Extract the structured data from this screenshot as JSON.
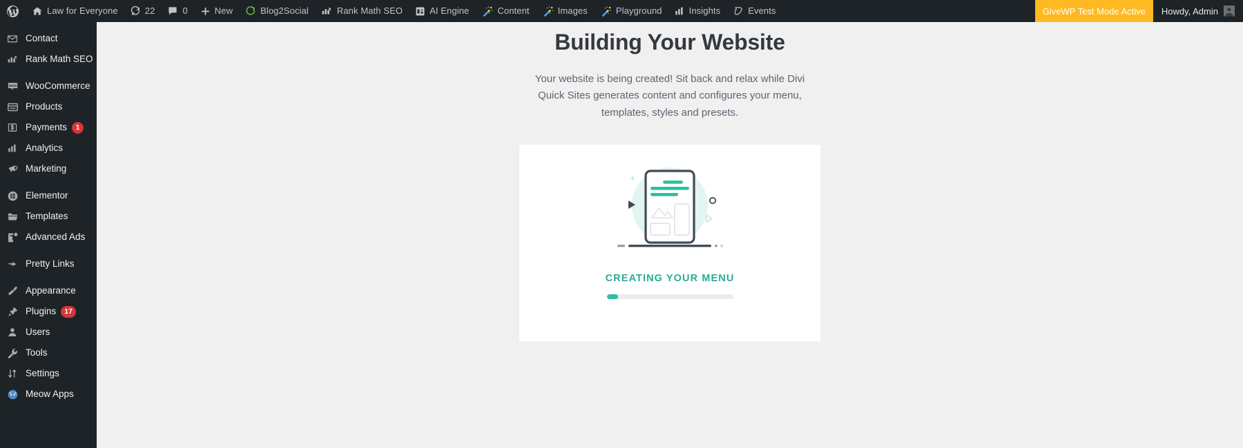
{
  "adminbar": {
    "items": [
      {
        "icon": "wordpress-logo-icon",
        "label": ""
      },
      {
        "icon": "home-icon",
        "label": "Law for Everyone"
      },
      {
        "icon": "update-icon",
        "label": "22"
      },
      {
        "icon": "comment-icon",
        "label": "0"
      },
      {
        "icon": "plus-icon",
        "label": "New"
      },
      {
        "icon": "blog2social-icon",
        "label": "Blog2Social"
      },
      {
        "icon": "rank-math-icon",
        "label": "Rank Math SEO"
      },
      {
        "icon": "ai-engine-icon",
        "label": "AI Engine"
      },
      {
        "icon": "magic-wand-icon",
        "label": "Content"
      },
      {
        "icon": "magic-wand-icon",
        "label": "Images"
      },
      {
        "icon": "magic-wand-icon",
        "label": "Playground"
      },
      {
        "icon": "insights-bars-icon",
        "label": "Insights"
      },
      {
        "icon": "events-icon",
        "label": "Events"
      }
    ],
    "givewp_notice": "GiveWP Test Mode Active",
    "howdy": "Howdy, Admin"
  },
  "sidebar": {
    "items": [
      {
        "icon": "envelope-icon",
        "label": "Contact",
        "badge": "",
        "gap_before": false
      },
      {
        "icon": "rank-math-icon",
        "label": "Rank Math SEO",
        "badge": "",
        "gap_before": false
      },
      {
        "icon": "woocommerce-icon",
        "label": "WooCommerce",
        "badge": "",
        "gap_before": true
      },
      {
        "icon": "products-icon",
        "label": "Products",
        "badge": "",
        "gap_before": false
      },
      {
        "icon": "payments-icon",
        "label": "Payments",
        "badge": "1",
        "gap_before": false
      },
      {
        "icon": "analytics-icon",
        "label": "Analytics",
        "badge": "",
        "gap_before": false
      },
      {
        "icon": "marketing-icon",
        "label": "Marketing",
        "badge": "",
        "gap_before": false
      },
      {
        "icon": "elementor-icon",
        "label": "Elementor",
        "badge": "",
        "gap_before": true
      },
      {
        "icon": "templates-icon",
        "label": "Templates",
        "badge": "",
        "gap_before": false
      },
      {
        "icon": "advanced-ads-icon",
        "label": "Advanced Ads",
        "badge": "",
        "gap_before": false
      },
      {
        "icon": "pretty-links-icon",
        "label": "Pretty Links",
        "badge": "",
        "gap_before": true
      },
      {
        "icon": "appearance-icon",
        "label": "Appearance",
        "badge": "",
        "gap_before": true
      },
      {
        "icon": "plugins-icon",
        "label": "Plugins",
        "badge": "17",
        "gap_before": false
      },
      {
        "icon": "users-icon",
        "label": "Users",
        "badge": "",
        "gap_before": false
      },
      {
        "icon": "tools-icon",
        "label": "Tools",
        "badge": "",
        "gap_before": false
      },
      {
        "icon": "settings-icon",
        "label": "Settings",
        "badge": "",
        "gap_before": false
      },
      {
        "icon": "meow-apps-icon",
        "label": "Meow Apps",
        "badge": "",
        "gap_before": false
      }
    ]
  },
  "main": {
    "title": "Building Your Website",
    "description": "Your website is being created! Sit back and relax while Divi Quick Sites generates content and configures your menu, templates, styles and presets.",
    "status": "Creating your menu",
    "progress_percent": 9
  },
  "colors": {
    "accent_teal": "#2bbfa0",
    "status_teal": "#2aab94",
    "admin_dark": "#1d2327",
    "givewp_yellow": "#ffb922",
    "badge_red": "#d63638",
    "page_bg": "#f0f0f1"
  }
}
